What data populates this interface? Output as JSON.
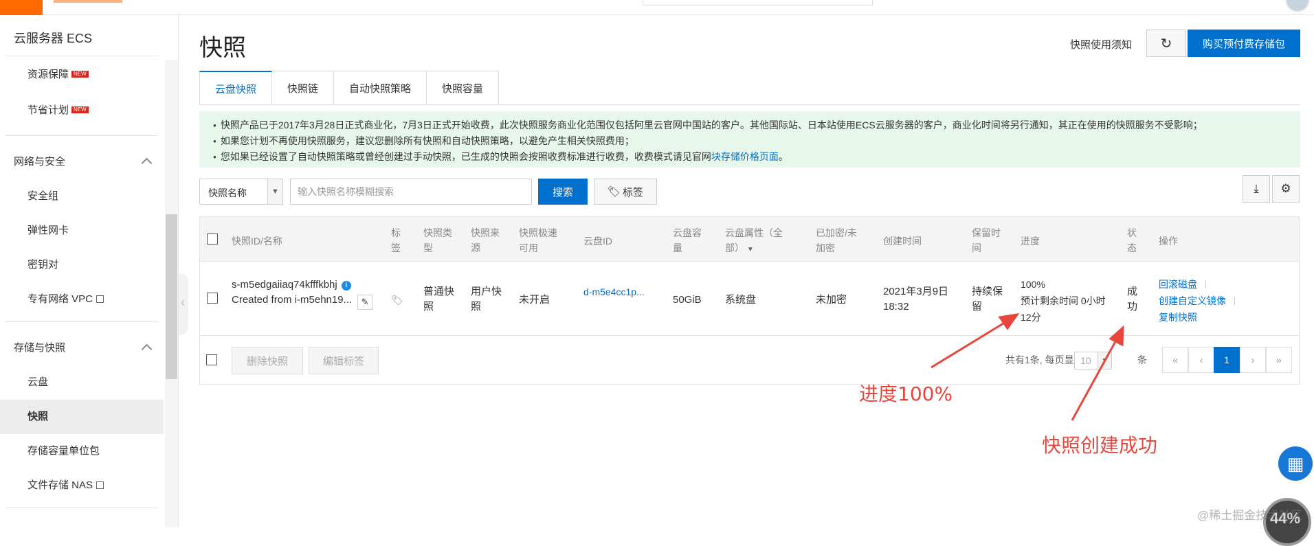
{
  "sidebar": {
    "title": "云服务器 ECS",
    "items_top": [
      {
        "label": "资源保障",
        "badge": "NEW"
      },
      {
        "label": "节省计划",
        "badge": "NEW"
      }
    ],
    "group_network": "网络与安全",
    "network_items": [
      "安全组",
      "弹性网卡",
      "密钥对",
      "专有网络 VPC"
    ],
    "group_storage": "存储与快照",
    "storage_items": [
      "云盘",
      "快照",
      "存储容量单位包",
      "文件存储 NAS"
    ]
  },
  "header": {
    "title": "快照",
    "notice_link": "快照使用须知",
    "buy_button": "购买预付费存储包"
  },
  "tabs": [
    "云盘快照",
    "快照链",
    "自动快照策略",
    "快照容量"
  ],
  "notice": {
    "line1": "快照产品已于2017年3月28日正式商业化，7月3日正式开始收费，此次快照服务商业化范围仅包括阿里云官网中国站的客户。其他国际站、日本站使用ECS云服务器的客户，商业化时间将另行通知，其正在使用的快照服务不受影响；",
    "line2": "如果您计划不再使用快照服务，建议您删除所有快照和自动快照策略，以避免产生相关快照费用；",
    "line3_prefix": "您如果已经设置了自动快照策略或曾经创建过手动快照，已生成的快照会按照收费标准进行收费，收费模式请见官网",
    "line3_link": "块存储价格页面",
    "line3_suffix": "。"
  },
  "toolbar": {
    "select_value": "快照名称",
    "search_placeholder": "输入快照名称模糊搜索",
    "search_button": "搜索",
    "tag_button": "标签"
  },
  "table": {
    "headers": {
      "id_name": "快照ID/名称",
      "tag_a": "标",
      "tag_b": "签",
      "type_a": "快照类",
      "type_b": "型",
      "source_a": "快照来",
      "source_b": "源",
      "speed_a": "快照极速",
      "speed_b": "可用",
      "disk_id": "云盘ID",
      "disk_size_a": "云盘容",
      "disk_size_b": "量",
      "disk_attr_a": "云盘属性（全",
      "disk_attr_b": "部）",
      "encrypted_a": "已加密/未",
      "encrypted_b": "加密",
      "created": "创建时间",
      "retention_a": "保留时",
      "retention_b": "间",
      "progress": "进度",
      "status_a": "状",
      "status_b": "态",
      "actions": "操作"
    },
    "row": {
      "snapshot_id": "s-m5edgaiiaq74kfffkbhj",
      "snapshot_name": "Created from i-m5ehn19...",
      "type_a": "普通快",
      "type_b": "照",
      "source_a": "用户快",
      "source_b": "照",
      "speed": "未开启",
      "disk_id": "d-m5e4cc1p...",
      "disk_size": "50GiB",
      "disk_attr": "系统盘",
      "encrypted": "未加密",
      "created_a": "2021年3月9日",
      "created_b": "18:32",
      "retention_a": "持续保",
      "retention_b": "留",
      "progress_pct": "100%",
      "progress_remaining_a": "预计剩余时间 0小时",
      "progress_remaining_b": "12分",
      "status_a": "成",
      "status_b": "功",
      "action_rollback": "回滚磁盘",
      "action_create_image": "创建自定义镜像",
      "action_copy": "复制快照"
    },
    "footer": {
      "delete_button": "删除快照",
      "edit_tags_button": "编辑标签",
      "pager_text": "共有1条, 每页显示:",
      "page_size": "10",
      "pager_unit": "条",
      "first": "«",
      "prev": "‹",
      "current": "1",
      "next": "›",
      "last": "»"
    }
  },
  "annotations": {
    "progress_note": "进度100%",
    "success_note": "快照创建成功"
  },
  "watermark": "@稀土掘金技术社区",
  "speed_widget": "44%",
  "colors": {
    "brand_orange": "#ff6a00",
    "primary_blue": "#0070cc",
    "annotation_red": "#e8453c",
    "notice_bg": "#e8f7ec"
  }
}
